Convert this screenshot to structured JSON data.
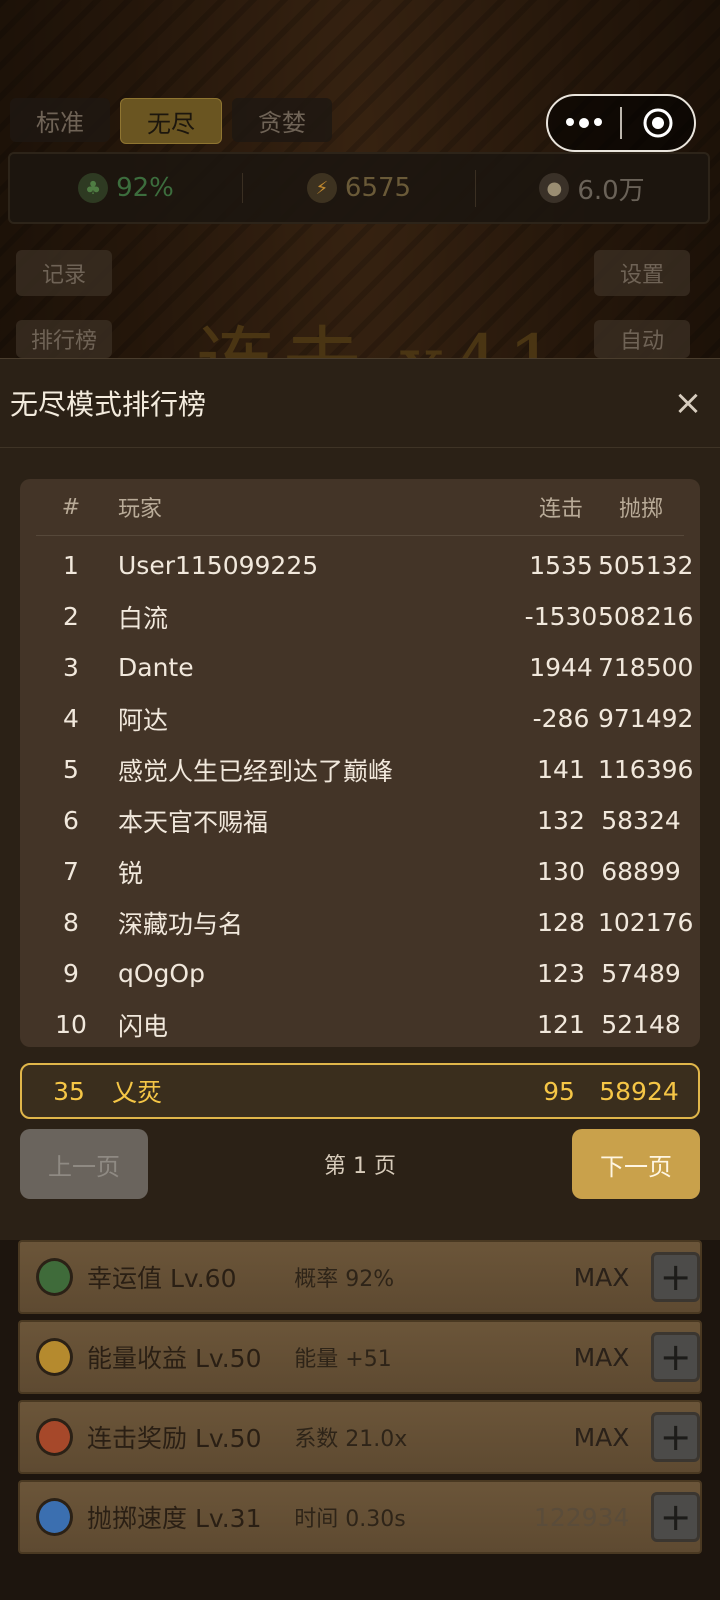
{
  "top": {
    "mode_tabs": [
      "标准",
      "无尽",
      "贪婪"
    ],
    "stats": {
      "luck": "92%",
      "energy": "6575",
      "money": "6.0万"
    },
    "side_left": [
      "记录",
      "排行榜"
    ],
    "side_right": [
      "设置",
      "自动"
    ],
    "combo_text": "连击 x41"
  },
  "modal": {
    "title": "无尽模式排行榜",
    "close": "×",
    "headers": {
      "rank": "#",
      "player": "玩家",
      "combo": "连击",
      "throw": "抛掷"
    },
    "rows": [
      {
        "rank": "1",
        "name": "User115099225",
        "combo": "1535",
        "throw": "505132"
      },
      {
        "rank": "2",
        "name": "白流",
        "combo": "-1530",
        "throw": "508216"
      },
      {
        "rank": "3",
        "name": "Dante",
        "combo": "1944",
        "throw": "718500"
      },
      {
        "rank": "4",
        "name": "阿达",
        "combo": "-286",
        "throw": "971492"
      },
      {
        "rank": "5",
        "name": "感觉人生已经到达了巅峰",
        "combo": "141",
        "throw": "116396"
      },
      {
        "rank": "6",
        "name": "本天官不赐福",
        "combo": "132",
        "throw": "58324"
      },
      {
        "rank": "7",
        "name": "锐",
        "combo": "130",
        "throw": "68899"
      },
      {
        "rank": "8",
        "name": "深藏功与名",
        "combo": "128",
        "throw": "102176"
      },
      {
        "rank": "9",
        "name": "qOgOp",
        "combo": "123",
        "throw": "57489"
      },
      {
        "rank": "10",
        "name": "闪电",
        "combo": "121",
        "throw": "52148"
      }
    ],
    "my_row": {
      "rank": "35",
      "name": "乂烎",
      "combo": "95",
      "throw": "58924"
    },
    "pager": {
      "prev": "上一页",
      "label": "第 1 页",
      "next": "下一页"
    }
  },
  "upgrades": [
    {
      "name": "幸运值 Lv.60",
      "desc": "概率 92%",
      "status": "MAX",
      "icon_color": "#3f6b3a"
    },
    {
      "name": "能量收益 Lv.50",
      "desc": "能量 +51",
      "status": "MAX",
      "icon_color": "#b58a2e"
    },
    {
      "name": "连击奖励 Lv.50",
      "desc": "系数 21.0x",
      "status": "MAX",
      "icon_color": "#a6482a"
    },
    {
      "name": "抛掷速度 Lv.31",
      "desc": "时间 0.30s",
      "status": "122934",
      "icon_color": "#3b6fb0"
    }
  ]
}
